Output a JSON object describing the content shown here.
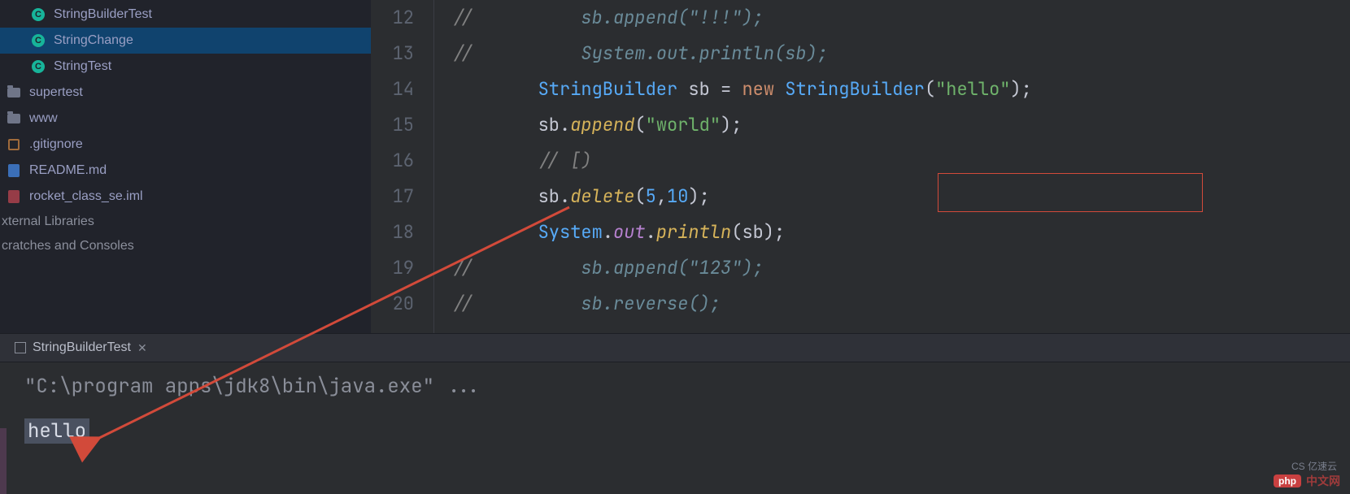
{
  "sidebar": {
    "items": [
      {
        "label": "StringBuilderTest",
        "kind": "class",
        "indent": 1
      },
      {
        "label": "StringChange",
        "kind": "class",
        "indent": 1,
        "selected": true
      },
      {
        "label": "StringTest",
        "kind": "class",
        "indent": 1
      },
      {
        "label": "supertest",
        "kind": "folder",
        "indent": 0
      },
      {
        "label": "www",
        "kind": "folder",
        "indent": 0
      },
      {
        "label": ".gitignore",
        "kind": "gitignore",
        "indent": 0
      },
      {
        "label": "README.md",
        "kind": "md",
        "indent": 0
      },
      {
        "label": "rocket_class_se.iml",
        "kind": "iml",
        "indent": 0
      }
    ],
    "sections": [
      "xternal Libraries",
      "cratches and Consoles"
    ]
  },
  "editor": {
    "line_numbers": [
      "12",
      "13",
      "14",
      "15",
      "16",
      "17",
      "18",
      "19",
      "20"
    ],
    "lines": {
      "l12": {
        "comment_prefix": "//",
        "code_cm": "sb.append(\"!!!\");"
      },
      "l13": {
        "comment_prefix": "//",
        "code_cm": "System.out.println(sb);"
      },
      "l14": {
        "type": "StringBuilder",
        "id": "sb",
        "eq": " = ",
        "kw": "new",
        "type2": " StringBuilder",
        "paren_o": "(",
        "str": "\"hello\"",
        "paren_c": ");"
      },
      "l15": {
        "id": "sb",
        "dot": ".",
        "mth": "append",
        "paren_o": "(",
        "str": "\"world\"",
        "paren_c": ");"
      },
      "l16": {
        "comment": "// [)"
      },
      "l17": {
        "id": "sb",
        "dot": ".",
        "mth": "delete",
        "paren_o": "(",
        "n1": "5",
        "comma": ",",
        "n2": "10",
        "paren_c": ");"
      },
      "l18": {
        "cls": "System",
        "dot1": ".",
        "fld": "out",
        "dot2": ".",
        "mth": "println",
        "paren_o": "(",
        "arg": "sb",
        "paren_c": ");"
      },
      "l19": {
        "comment_prefix": "//",
        "code_cm": "sb.append(\"123\");"
      },
      "l20": {
        "comment_prefix": "//",
        "code_cm": "sb.reverse();"
      }
    }
  },
  "console": {
    "tab_label": "StringBuilderTest",
    "command": "\"C:\\program apps\\jdk8\\bin\\java.exe\" ...",
    "output": "hello"
  },
  "watermark": {
    "badge": "php",
    "text": "中文网",
    "sub": "CS   亿速云"
  }
}
